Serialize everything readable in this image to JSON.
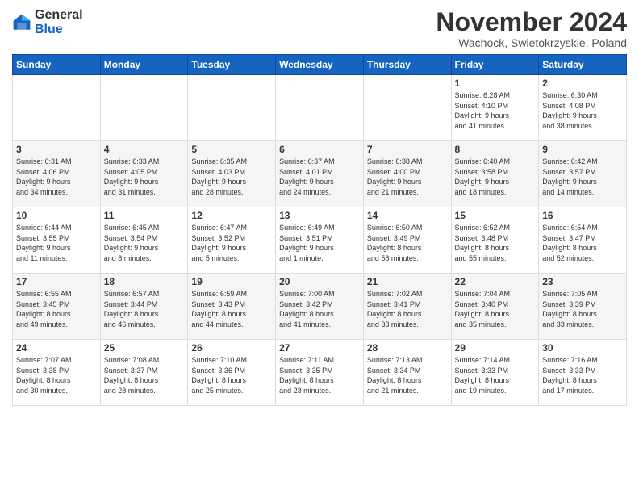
{
  "logo": {
    "general": "General",
    "blue": "Blue"
  },
  "header": {
    "month": "November 2024",
    "location": "Wachock, Swietokrzyskie, Poland"
  },
  "weekdays": [
    "Sunday",
    "Monday",
    "Tuesday",
    "Wednesday",
    "Thursday",
    "Friday",
    "Saturday"
  ],
  "weeks": [
    [
      {
        "day": "",
        "info": ""
      },
      {
        "day": "",
        "info": ""
      },
      {
        "day": "",
        "info": ""
      },
      {
        "day": "",
        "info": ""
      },
      {
        "day": "",
        "info": ""
      },
      {
        "day": "1",
        "info": "Sunrise: 6:28 AM\nSunset: 4:10 PM\nDaylight: 9 hours\nand 41 minutes."
      },
      {
        "day": "2",
        "info": "Sunrise: 6:30 AM\nSunset: 4:08 PM\nDaylight: 9 hours\nand 38 minutes."
      }
    ],
    [
      {
        "day": "3",
        "info": "Sunrise: 6:31 AM\nSunset: 4:06 PM\nDaylight: 9 hours\nand 34 minutes."
      },
      {
        "day": "4",
        "info": "Sunrise: 6:33 AM\nSunset: 4:05 PM\nDaylight: 9 hours\nand 31 minutes."
      },
      {
        "day": "5",
        "info": "Sunrise: 6:35 AM\nSunset: 4:03 PM\nDaylight: 9 hours\nand 28 minutes."
      },
      {
        "day": "6",
        "info": "Sunrise: 6:37 AM\nSunset: 4:01 PM\nDaylight: 9 hours\nand 24 minutes."
      },
      {
        "day": "7",
        "info": "Sunrise: 6:38 AM\nSunset: 4:00 PM\nDaylight: 9 hours\nand 21 minutes."
      },
      {
        "day": "8",
        "info": "Sunrise: 6:40 AM\nSunset: 3:58 PM\nDaylight: 9 hours\nand 18 minutes."
      },
      {
        "day": "9",
        "info": "Sunrise: 6:42 AM\nSunset: 3:57 PM\nDaylight: 9 hours\nand 14 minutes."
      }
    ],
    [
      {
        "day": "10",
        "info": "Sunrise: 6:44 AM\nSunset: 3:55 PM\nDaylight: 9 hours\nand 11 minutes."
      },
      {
        "day": "11",
        "info": "Sunrise: 6:45 AM\nSunset: 3:54 PM\nDaylight: 9 hours\nand 8 minutes."
      },
      {
        "day": "12",
        "info": "Sunrise: 6:47 AM\nSunset: 3:52 PM\nDaylight: 9 hours\nand 5 minutes."
      },
      {
        "day": "13",
        "info": "Sunrise: 6:49 AM\nSunset: 3:51 PM\nDaylight: 9 hours\nand 1 minute."
      },
      {
        "day": "14",
        "info": "Sunrise: 6:50 AM\nSunset: 3:49 PM\nDaylight: 8 hours\nand 58 minutes."
      },
      {
        "day": "15",
        "info": "Sunrise: 6:52 AM\nSunset: 3:48 PM\nDaylight: 8 hours\nand 55 minutes."
      },
      {
        "day": "16",
        "info": "Sunrise: 6:54 AM\nSunset: 3:47 PM\nDaylight: 8 hours\nand 52 minutes."
      }
    ],
    [
      {
        "day": "17",
        "info": "Sunrise: 6:55 AM\nSunset: 3:45 PM\nDaylight: 8 hours\nand 49 minutes."
      },
      {
        "day": "18",
        "info": "Sunrise: 6:57 AM\nSunset: 3:44 PM\nDaylight: 8 hours\nand 46 minutes."
      },
      {
        "day": "19",
        "info": "Sunrise: 6:59 AM\nSunset: 3:43 PM\nDaylight: 8 hours\nand 44 minutes."
      },
      {
        "day": "20",
        "info": "Sunrise: 7:00 AM\nSunset: 3:42 PM\nDaylight: 8 hours\nand 41 minutes."
      },
      {
        "day": "21",
        "info": "Sunrise: 7:02 AM\nSunset: 3:41 PM\nDaylight: 8 hours\nand 38 minutes."
      },
      {
        "day": "22",
        "info": "Sunrise: 7:04 AM\nSunset: 3:40 PM\nDaylight: 8 hours\nand 35 minutes."
      },
      {
        "day": "23",
        "info": "Sunrise: 7:05 AM\nSunset: 3:39 PM\nDaylight: 8 hours\nand 33 minutes."
      }
    ],
    [
      {
        "day": "24",
        "info": "Sunrise: 7:07 AM\nSunset: 3:38 PM\nDaylight: 8 hours\nand 30 minutes."
      },
      {
        "day": "25",
        "info": "Sunrise: 7:08 AM\nSunset: 3:37 PM\nDaylight: 8 hours\nand 28 minutes."
      },
      {
        "day": "26",
        "info": "Sunrise: 7:10 AM\nSunset: 3:36 PM\nDaylight: 8 hours\nand 25 minutes."
      },
      {
        "day": "27",
        "info": "Sunrise: 7:11 AM\nSunset: 3:35 PM\nDaylight: 8 hours\nand 23 minutes."
      },
      {
        "day": "28",
        "info": "Sunrise: 7:13 AM\nSunset: 3:34 PM\nDaylight: 8 hours\nand 21 minutes."
      },
      {
        "day": "29",
        "info": "Sunrise: 7:14 AM\nSunset: 3:33 PM\nDaylight: 8 hours\nand 19 minutes."
      },
      {
        "day": "30",
        "info": "Sunrise: 7:16 AM\nSunset: 3:33 PM\nDaylight: 8 hours\nand 17 minutes."
      }
    ]
  ]
}
